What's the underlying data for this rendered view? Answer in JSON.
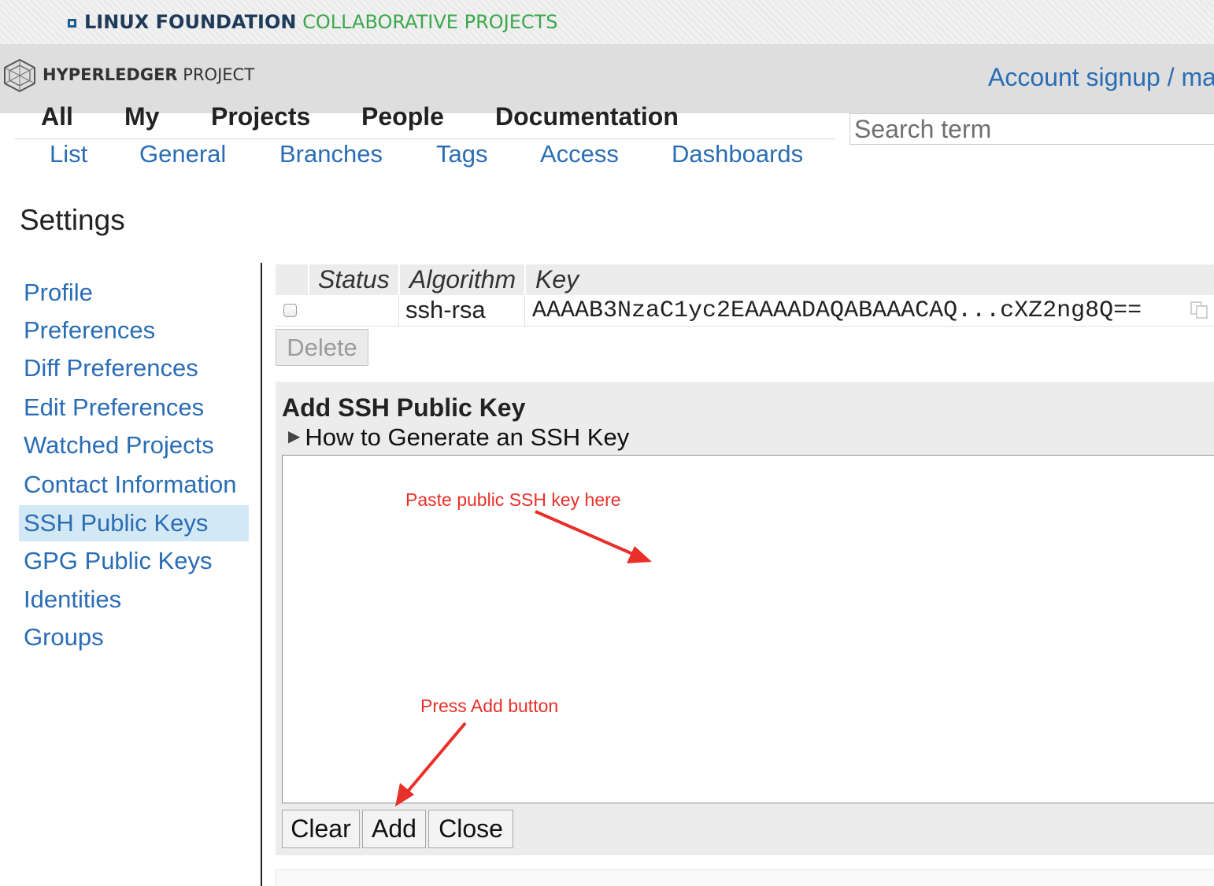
{
  "banner": {
    "lf_bold": "LINUX FOUNDATION",
    "lf_collab": "COLLABORATIVE PROJECTS"
  },
  "header": {
    "logo_bold": "HYPERLEDGER",
    "logo_rest": " PROJECT",
    "account_link": "Account signup / ma"
  },
  "topnav": [
    "All",
    "My",
    "Projects",
    "People",
    "Documentation"
  ],
  "subnav": [
    "List",
    "General",
    "Branches",
    "Tags",
    "Access",
    "Dashboards"
  ],
  "search": {
    "placeholder": "Search term"
  },
  "page_title": "Settings",
  "sidebar": {
    "items": [
      {
        "label": "Profile"
      },
      {
        "label": "Preferences"
      },
      {
        "label": "Diff Preferences"
      },
      {
        "label": "Edit Preferences"
      },
      {
        "label": "Watched Projects"
      },
      {
        "label": "Contact Information"
      },
      {
        "label": "SSH Public Keys",
        "active": true
      },
      {
        "label": "GPG Public Keys"
      },
      {
        "label": "Identities"
      },
      {
        "label": "Groups"
      }
    ]
  },
  "keys_table": {
    "columns": [
      "Status",
      "Algorithm",
      "Key"
    ],
    "rows": [
      {
        "status": "",
        "algorithm": "ssh-rsa",
        "key": "AAAAB3NzaC1yc2EAAAADAQABAAACAQ...cXZ2ng8Q=="
      }
    ]
  },
  "delete_label": "Delete",
  "add_panel": {
    "title": "Add SSH Public Key",
    "howto": "How to Generate an SSH Key",
    "buttons": {
      "clear": "Clear",
      "add": "Add",
      "close": "Close"
    }
  },
  "annotations": {
    "paste": "Paste public SSH key here",
    "press": "Press Add button",
    "color": "#e8302a"
  },
  "colors": {
    "link": "#2a6db5",
    "active_item_bg": "#d3e8f5",
    "lf_green": "#3aa74a",
    "lf_navy": "#1f3b5a"
  },
  "icons": {
    "lf_logo": "lf-square-icon",
    "hl_logo": "hyperledger-logo-icon",
    "expand": "triangle-right-icon",
    "copy": "copy-icon"
  }
}
